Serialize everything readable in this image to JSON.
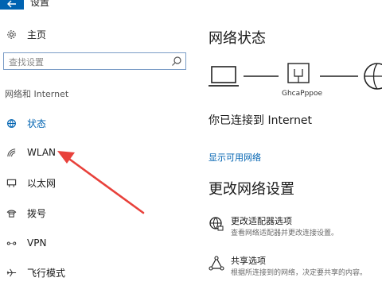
{
  "window": {
    "title": "设置"
  },
  "sidebar": {
    "home_label": "主页",
    "search_placeholder": "查找设置",
    "section_label": "网络和 Internet",
    "items": [
      {
        "label": "状态",
        "icon": "status-globe-icon",
        "active": true
      },
      {
        "label": "WLAN",
        "icon": "wifi-icon"
      },
      {
        "label": "以太网",
        "icon": "ethernet-icon"
      },
      {
        "label": "拨号",
        "icon": "dialup-icon"
      },
      {
        "label": "VPN",
        "icon": "vpn-icon"
      },
      {
        "label": "飞行模式",
        "icon": "airplane-icon"
      }
    ]
  },
  "main": {
    "network_status_title": "网络状态",
    "gateway_label": "GhcaPppoe",
    "connection_status": "你已连接到 Internet",
    "show_networks_link": "显示可用网络",
    "change_settings_title": "更改网络设置",
    "options": [
      {
        "title": "更改适配器选项",
        "desc": "查看网络适配器并更改连接设置。",
        "icon": "adapter-globe-icon"
      },
      {
        "title": "共享选项",
        "desc": "根据所连接到的网络，决定要共享的内容。",
        "icon": "sharing-icon"
      }
    ]
  },
  "colors": {
    "accent": "#0063b1",
    "annotation_arrow": "#e8413b"
  }
}
